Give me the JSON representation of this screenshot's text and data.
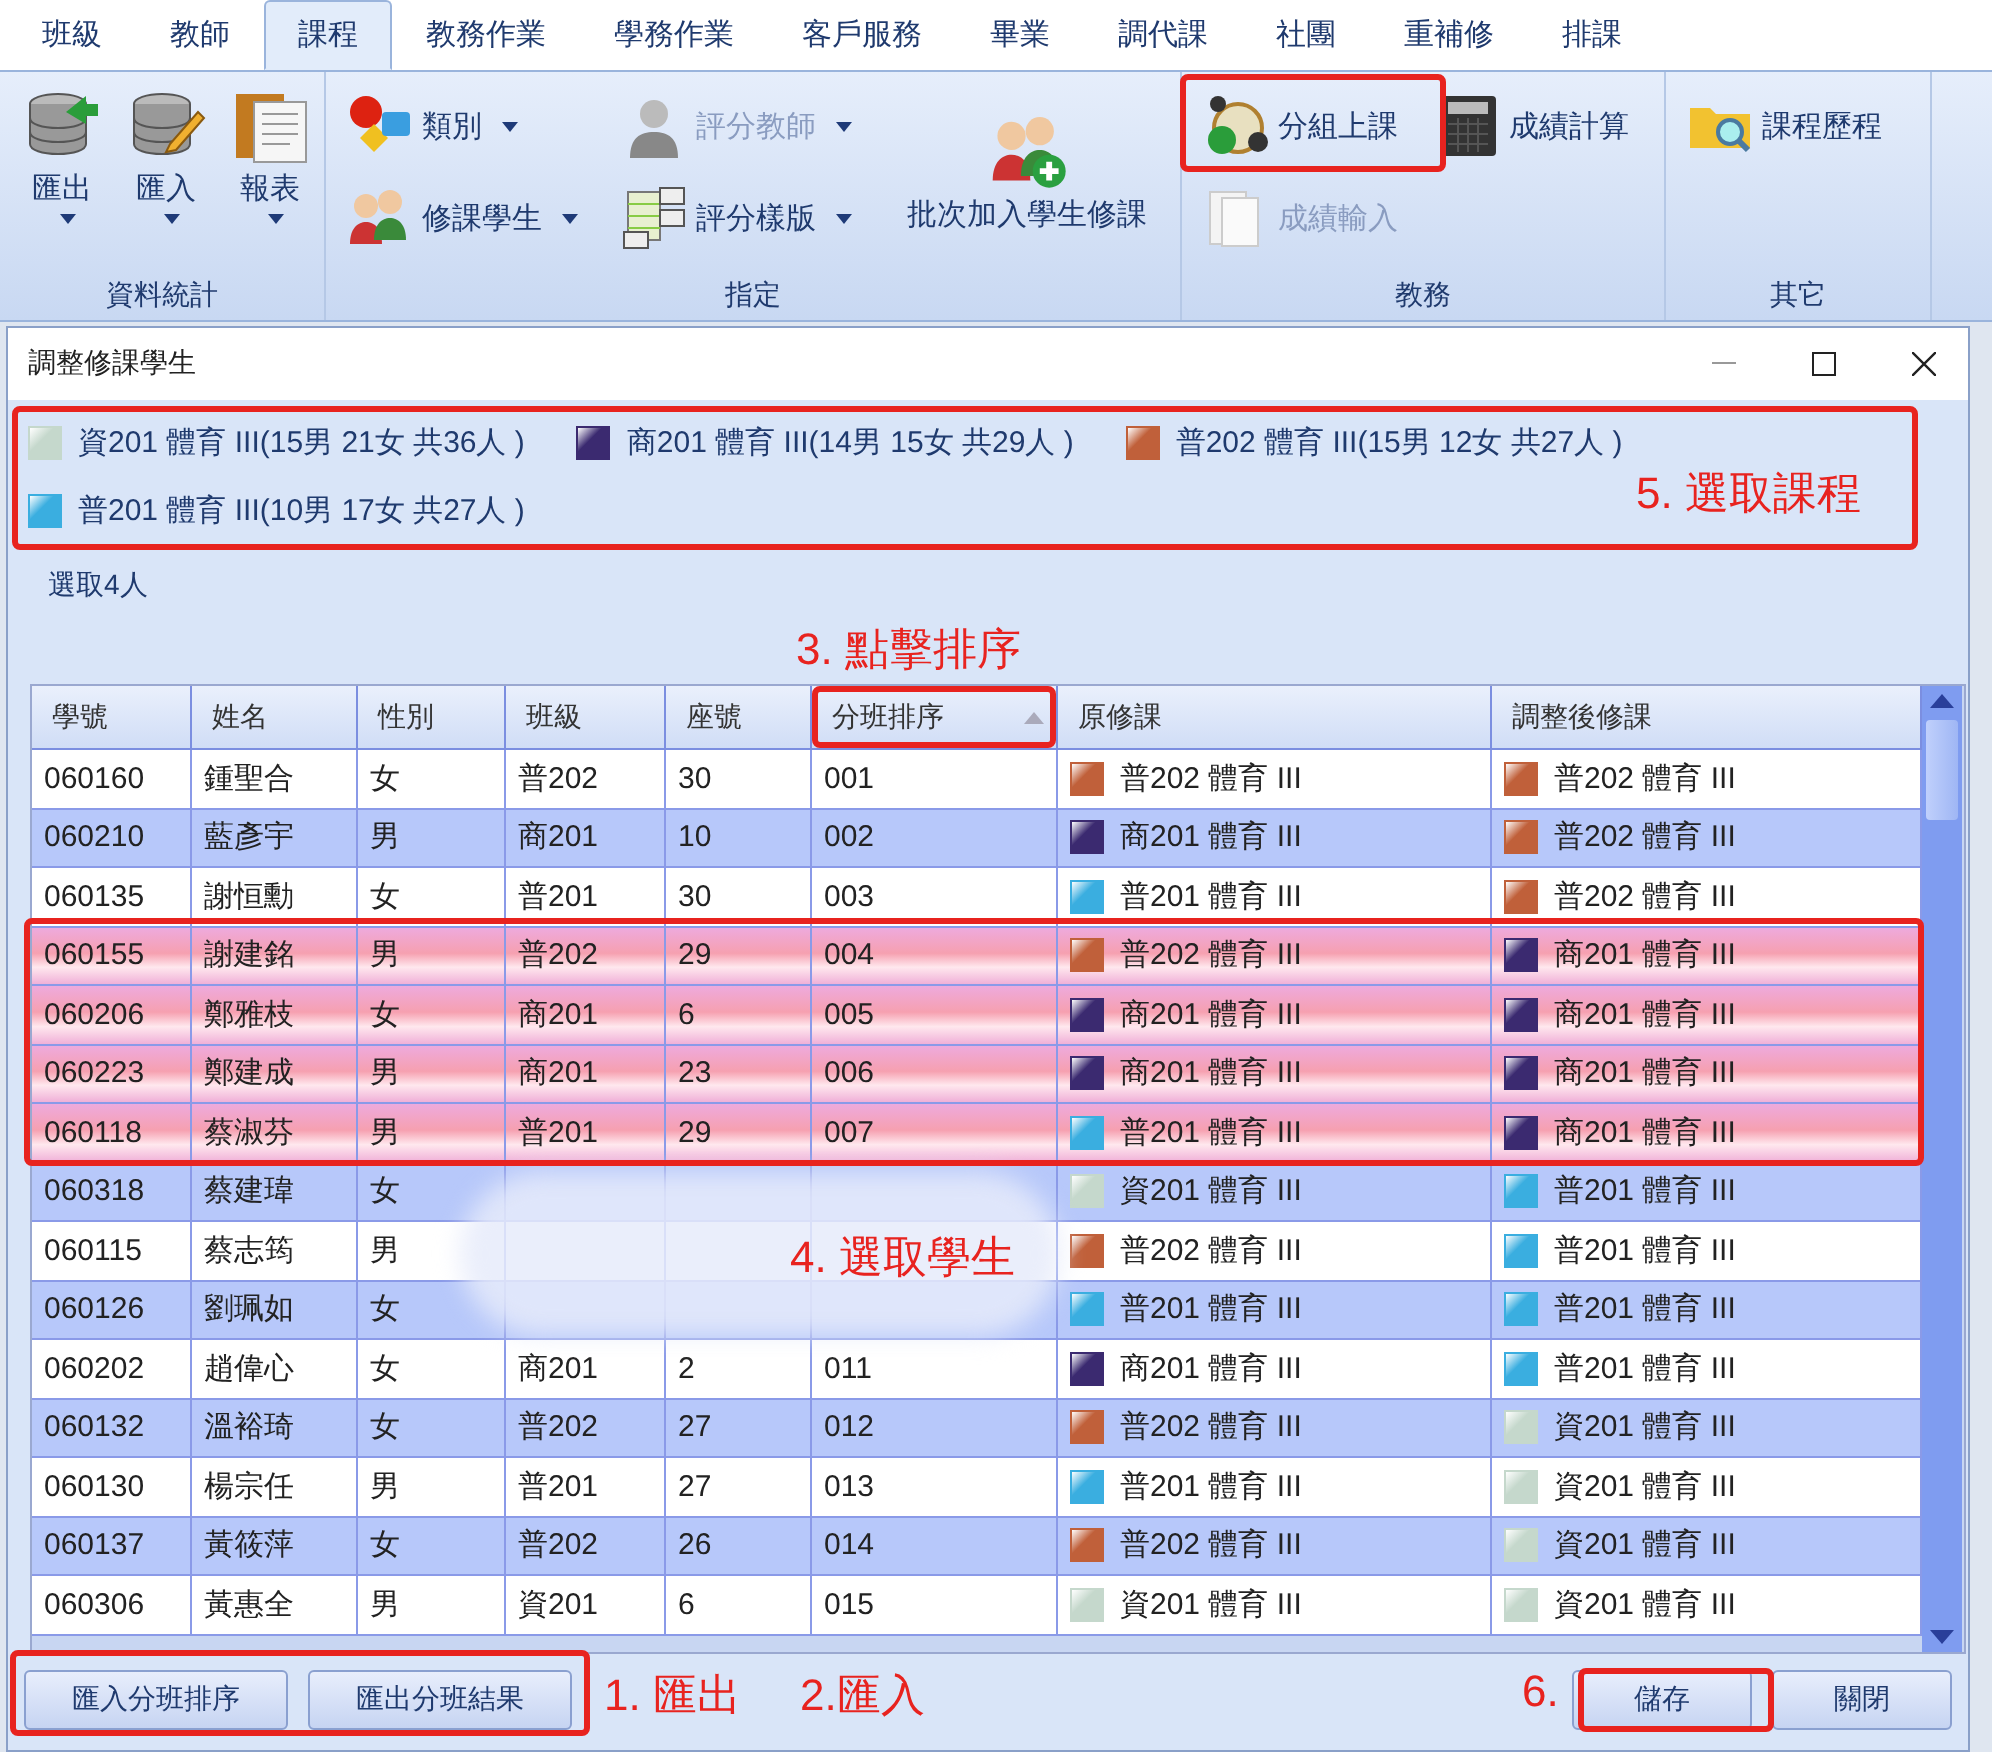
{
  "ribbon_tabs": [
    {
      "label": "班級",
      "selected": false
    },
    {
      "label": "教師",
      "selected": false
    },
    {
      "label": "課程",
      "selected": true
    },
    {
      "label": "教務作業",
      "selected": false
    },
    {
      "label": "學務作業",
      "selected": false
    },
    {
      "label": "客戶服務",
      "selected": false
    },
    {
      "label": "畢業",
      "selected": false
    },
    {
      "label": "調代課",
      "selected": false
    },
    {
      "label": "社團",
      "selected": false
    },
    {
      "label": "重補修",
      "selected": false
    },
    {
      "label": "排課",
      "selected": false
    }
  ],
  "ribbon_groups": [
    {
      "title": "資料統計",
      "items": [
        {
          "label": "匯出",
          "kind": "large",
          "dropdown": true,
          "disabled": false
        },
        {
          "label": "匯入",
          "kind": "large",
          "dropdown": true,
          "disabled": false
        },
        {
          "label": "報表",
          "kind": "large",
          "dropdown": true,
          "disabled": false
        }
      ]
    },
    {
      "title": "指定",
      "items": [
        {
          "label": "類別",
          "kind": "small",
          "dropdown": true,
          "disabled": false
        },
        {
          "label": "修課學生",
          "kind": "small",
          "dropdown": true,
          "disabled": false
        },
        {
          "label": "評分教師",
          "kind": "small",
          "dropdown": true,
          "disabled": true
        },
        {
          "label": "評分樣版",
          "kind": "small",
          "dropdown": true,
          "disabled": false
        },
        {
          "label": "批次加入學生修課",
          "kind": "large",
          "dropdown": false,
          "disabled": false
        }
      ]
    },
    {
      "title": "教務",
      "items": [
        {
          "label": "分組上課",
          "kind": "small",
          "dropdown": false,
          "disabled": false
        },
        {
          "label": "成績輸入",
          "kind": "small",
          "dropdown": false,
          "disabled": true
        },
        {
          "label": "成績計算",
          "kind": "small",
          "dropdown": false,
          "disabled": false
        }
      ]
    },
    {
      "title": "其它",
      "items": [
        {
          "label": "課程歷程",
          "kind": "small",
          "dropdown": false,
          "disabled": false
        }
      ]
    }
  ],
  "dialog": {
    "title": "調整修課學生",
    "courses": [
      {
        "label": "資201 體育 III(15男 21女 共36人 )",
        "color": "#c5d8cc"
      },
      {
        "label": "商201 體育 III(14男 15女 共29人 )",
        "color": "#3b2a70"
      },
      {
        "label": "普202 體育 III(15男 12女 共27人 )",
        "color": "#c0603a"
      },
      {
        "label": "普201 體育 III(10男 17女 共27人 )",
        "color": "#3aaee0"
      }
    ],
    "selection_count": "選取4人",
    "table": {
      "columns": [
        {
          "label": "學號"
        },
        {
          "label": "姓名"
        },
        {
          "label": "性別"
        },
        {
          "label": "班級"
        },
        {
          "label": "座號"
        },
        {
          "label": "分班排序",
          "sort_ascending": true
        },
        {
          "label": "原修課"
        },
        {
          "label": "調整後修課"
        }
      ],
      "rows": [
        {
          "id": "060160",
          "name": "鍾聖合",
          "gender": "女",
          "class": "普202",
          "seat": "30",
          "order": "001",
          "original": {
            "text": "普202 體育 III",
            "color": "#c0603a"
          },
          "adjusted": {
            "text": "普202 體育 III",
            "color": "#c0603a"
          },
          "selected": false
        },
        {
          "id": "060210",
          "name": "藍彥宇",
          "gender": "男",
          "class": "商201",
          "seat": "10",
          "order": "002",
          "original": {
            "text": "商201 體育 III",
            "color": "#3b2a70"
          },
          "adjusted": {
            "text": "普202 體育 III",
            "color": "#c0603a"
          },
          "selected": false
        },
        {
          "id": "060135",
          "name": "謝恒勳",
          "gender": "女",
          "class": "普201",
          "seat": "30",
          "order": "003",
          "original": {
            "text": "普201 體育 III",
            "color": "#3aaee0"
          },
          "adjusted": {
            "text": "普202 體育 III",
            "color": "#c0603a"
          },
          "selected": false
        },
        {
          "id": "060155",
          "name": "謝建銘",
          "gender": "男",
          "class": "普202",
          "seat": "29",
          "order": "004",
          "original": {
            "text": "普202 體育 III",
            "color": "#c0603a"
          },
          "adjusted": {
            "text": "商201 體育 III",
            "color": "#3b2a70"
          },
          "selected": true
        },
        {
          "id": "060206",
          "name": "鄭雅枝",
          "gender": "女",
          "class": "商201",
          "seat": "6",
          "order": "005",
          "original": {
            "text": "商201 體育 III",
            "color": "#3b2a70"
          },
          "adjusted": {
            "text": "商201 體育 III",
            "color": "#3b2a70"
          },
          "selected": true
        },
        {
          "id": "060223",
          "name": "鄭建成",
          "gender": "男",
          "class": "商201",
          "seat": "23",
          "order": "006",
          "original": {
            "text": "商201 體育 III",
            "color": "#3b2a70"
          },
          "adjusted": {
            "text": "商201 體育 III",
            "color": "#3b2a70"
          },
          "selected": true
        },
        {
          "id": "060118",
          "name": "蔡淑芬",
          "gender": "男",
          "class": "普201",
          "seat": "29",
          "order": "007",
          "original": {
            "text": "普201 體育 III",
            "color": "#3aaee0"
          },
          "adjusted": {
            "text": "商201 體育 III",
            "color": "#3b2a70"
          },
          "selected": true
        },
        {
          "id": "060318",
          "name": "蔡建瑋",
          "gender": "女",
          "original": {
            "text": "資201 體育 III",
            "color": "#c5d8cc"
          },
          "adjusted": {
            "text": "普201 體育 III",
            "color": "#3aaee0"
          },
          "selected": false
        },
        {
          "id": "060115",
          "name": "蔡志筠",
          "gender": "男",
          "original": {
            "text": "普202 體育 III",
            "color": "#c0603a"
          },
          "adjusted": {
            "text": "普201 體育 III",
            "color": "#3aaee0"
          },
          "selected": false
        },
        {
          "id": "060126",
          "name": "劉珮如",
          "gender": "女",
          "original": {
            "text": "普201 體育 III",
            "color": "#3aaee0"
          },
          "adjusted": {
            "text": "普201 體育 III",
            "color": "#3aaee0"
          },
          "selected": false
        },
        {
          "id": "060202",
          "name": "趙偉心",
          "gender": "女",
          "class": "商201",
          "seat": "2",
          "order": "011",
          "original": {
            "text": "商201 體育 III",
            "color": "#3b2a70"
          },
          "adjusted": {
            "text": "普201 體育 III",
            "color": "#3aaee0"
          },
          "selected": false
        },
        {
          "id": "060132",
          "name": "溫裕琦",
          "gender": "女",
          "class": "普202",
          "seat": "27",
          "order": "012",
          "original": {
            "text": "普202 體育 III",
            "color": "#c0603a"
          },
          "adjusted": {
            "text": "資201 體育 III",
            "color": "#c5d8cc"
          },
          "selected": false
        },
        {
          "id": "060130",
          "name": "楊宗任",
          "gender": "男",
          "class": "普201",
          "seat": "27",
          "order": "013",
          "original": {
            "text": "普201 體育 III",
            "color": "#3aaee0"
          },
          "adjusted": {
            "text": "資201 體育 III",
            "color": "#c5d8cc"
          },
          "selected": false
        },
        {
          "id": "060137",
          "name": "黃筱萍",
          "gender": "女",
          "class": "普202",
          "seat": "26",
          "order": "014",
          "original": {
            "text": "普202 體育 III",
            "color": "#c0603a"
          },
          "adjusted": {
            "text": "資201 體育 III",
            "color": "#c5d8cc"
          },
          "selected": false
        },
        {
          "id": "060306",
          "name": "黃惠全",
          "gender": "男",
          "class": "資201",
          "seat": "6",
          "order": "015",
          "original": {
            "text": "資201 體育 III",
            "color": "#c5d8cc"
          },
          "adjusted": {
            "text": "資201 體育 III",
            "color": "#c5d8cc"
          },
          "selected": false
        }
      ]
    },
    "left_buttons": [
      "匯入分班排序",
      "匯出分班結果"
    ],
    "right_buttons": [
      "儲存",
      "關閉"
    ]
  },
  "annotations": [
    {
      "text": "5. 選取課程"
    },
    {
      "text": "3. 點擊排序"
    },
    {
      "text": "4. 選取學生"
    },
    {
      "text": "1. 匯出"
    },
    {
      "text": "2.匯入"
    },
    {
      "text": "6."
    }
  ]
}
